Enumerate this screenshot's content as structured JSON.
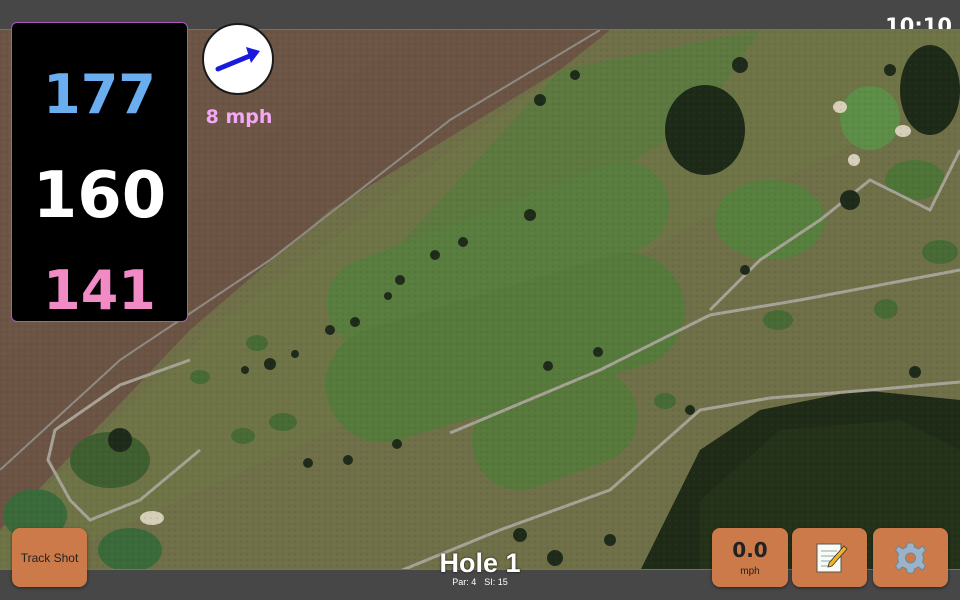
{
  "status_bar": {
    "time": "10:10"
  },
  "yardages": {
    "back": "177",
    "center": "160",
    "front": "141"
  },
  "wind": {
    "speed": "8 mph",
    "arrow_icon": "wind-arrow-icon",
    "arrow_color": "#1a1adf"
  },
  "hole": {
    "title": "Hole 1",
    "par": "Par: 4",
    "stroke_index": "SI: 15"
  },
  "buttons": {
    "track_shot": "Track Shot",
    "speed_value": "0.0",
    "speed_unit": "mph",
    "notes_icon": "notepad-icon",
    "settings_icon": "gear-icon"
  },
  "colors": {
    "back_yardage": "#6aaef0",
    "center_yardage": "#ffffff",
    "front_yardage": "#f08bc6",
    "wind_text": "#f3a7f5",
    "button_bg": "#cc7a4a"
  }
}
